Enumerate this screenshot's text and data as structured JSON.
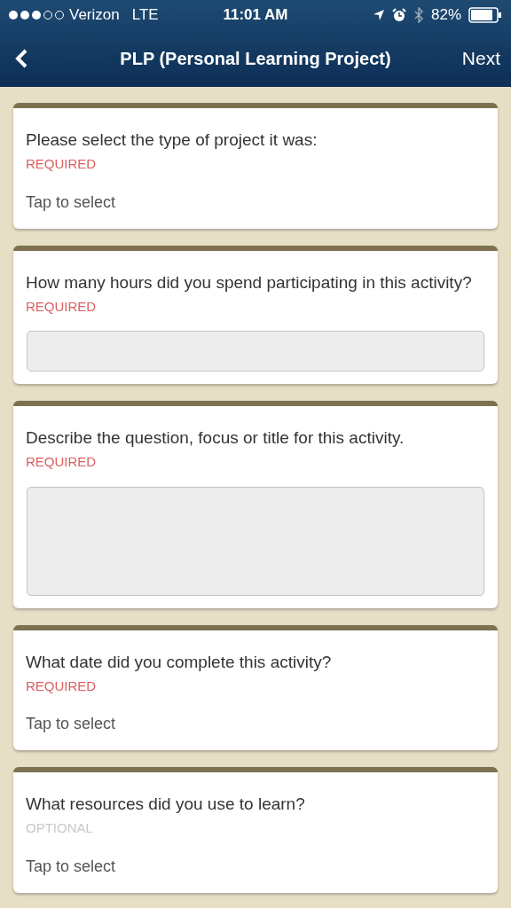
{
  "status_bar": {
    "carrier": "Verizon",
    "network": "LTE",
    "time": "11:01 AM",
    "battery": "82%"
  },
  "nav": {
    "title": "PLP (Personal Learning Project)",
    "action": "Next"
  },
  "questions": [
    {
      "kind": "select",
      "question": "Please select the type of project it was:",
      "requirement": "REQUIRED",
      "required": true,
      "placeholder": "Tap to select"
    },
    {
      "kind": "input",
      "question": "How many hours did you spend participating in this activity?",
      "requirement": "REQUIRED",
      "required": true
    },
    {
      "kind": "textarea",
      "question": "Describe the question, focus or title for this activity.",
      "requirement": "REQUIRED",
      "required": true
    },
    {
      "kind": "select",
      "question": "What date did you complete this activity?",
      "requirement": "REQUIRED",
      "required": true,
      "placeholder": "Tap to select"
    },
    {
      "kind": "select",
      "question": "What resources did you use to learn?",
      "requirement": "OPTIONAL",
      "required": false,
      "placeholder": "Tap to select"
    }
  ]
}
